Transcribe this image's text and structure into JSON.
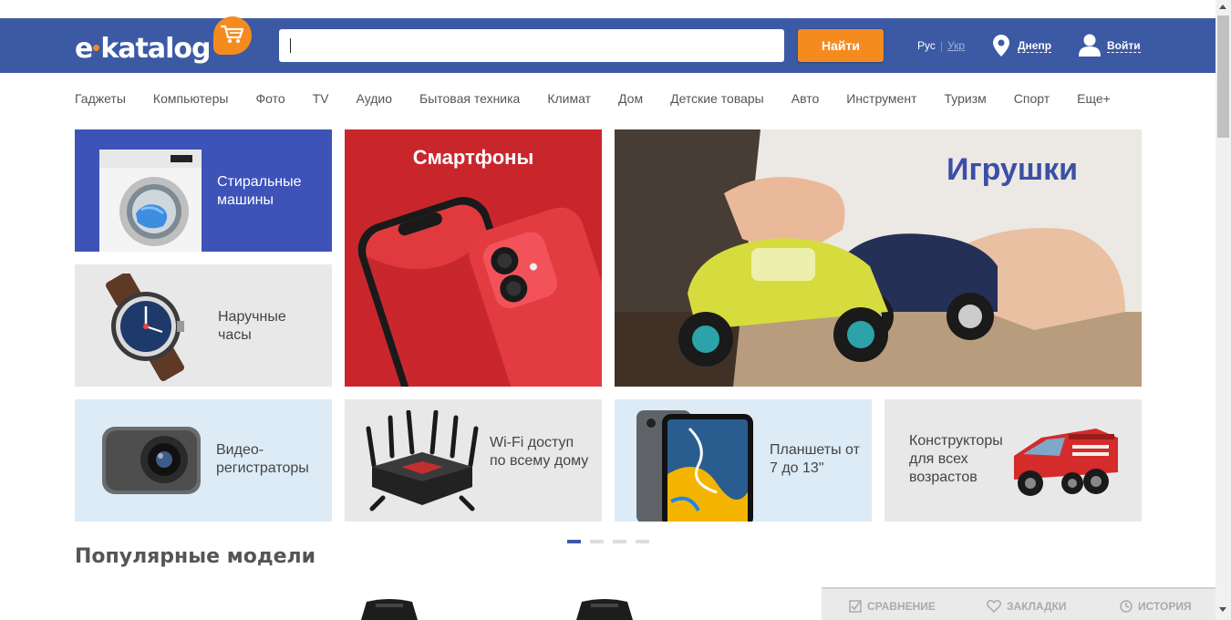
{
  "header": {
    "logo_text": "e",
    "logo_text_2": "katalog",
    "search_placeholder": "",
    "search_button": "Найти",
    "lang_ru": "Рус",
    "lang_sep": "|",
    "lang_uk": "Укр",
    "city": "Днепр",
    "login": "Войти",
    "brand_color": "#3c59a4",
    "accent_color": "#f58b1f"
  },
  "nav": {
    "items": [
      "Гаджеты",
      "Компьютеры",
      "Фото",
      "TV",
      "Аудио",
      "Бытовая техника",
      "Климат",
      "Дом",
      "Детские товары",
      "Авто",
      "Инструмент",
      "Туризм",
      "Спорт",
      "Еще+"
    ]
  },
  "tiles": {
    "washing": "Стиральные машины",
    "watches": "Наручные часы",
    "smartphones": "Смартфоны",
    "toys": "Игрушки",
    "dashcams": "Видео-регистраторы",
    "wifi": "Wi-Fi доступ по всему дому",
    "tablets": "Планшеты от 7 до 13\"",
    "constructors": "Конструкторы для всех возрастов"
  },
  "carousel": {
    "active_index": 0,
    "count": 4
  },
  "popular": {
    "title": "Популярные модели"
  },
  "bottom_bar": {
    "compare": "СРАВНЕНИЕ",
    "bookmarks": "ЗАКЛАДКИ",
    "history": "ИСТОРИЯ"
  }
}
